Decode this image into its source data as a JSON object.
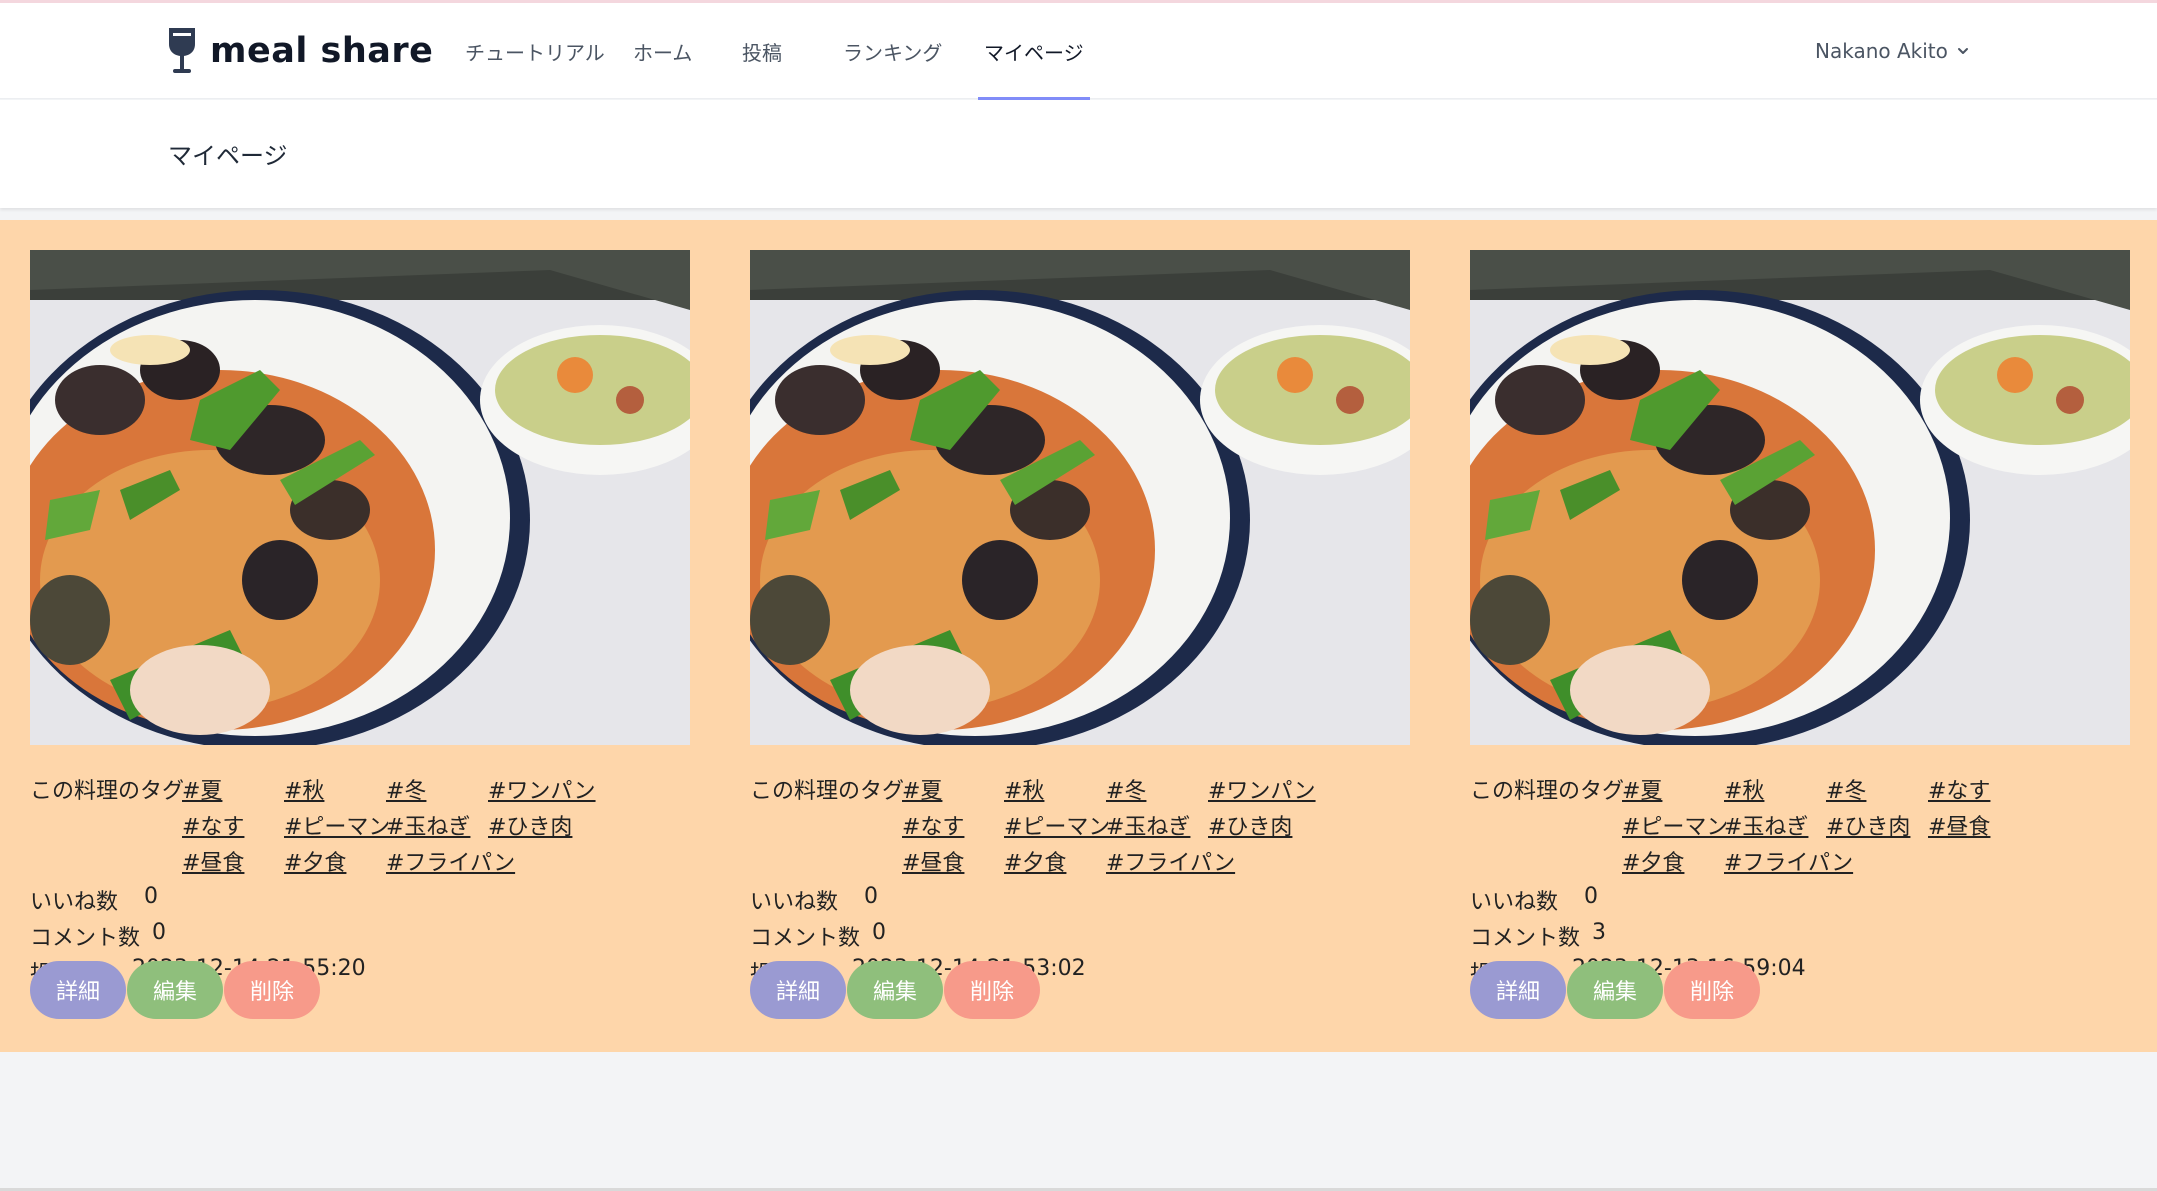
{
  "app": {
    "name": "meal share"
  },
  "nav": {
    "links": [
      {
        "label": "チュートリアル"
      },
      {
        "label": "ホーム"
      },
      {
        "label": "投稿"
      },
      {
        "label": "ランキング"
      },
      {
        "label": "マイページ",
        "active": true
      }
    ],
    "user": {
      "name": "Nakano Akito"
    }
  },
  "page": {
    "title": "マイページ"
  },
  "posts": [
    {
      "image": "photo-pasta-eggplant-pepper-with-soup",
      "tags_label": "この料理のタグ",
      "tags": [
        "#夏",
        "#秋",
        "#冬",
        "#ワンパン",
        "#なす",
        "#ピーマン",
        "#玉ねぎ",
        "#ひき肉",
        "#昼食",
        "#夕食",
        "#フライパン"
      ],
      "likes_label": "いいね数",
      "likes": "0",
      "comments_label": "コメント数",
      "comments": "0",
      "date_label": "投稿日",
      "date": "2023-12-14 21:55:20",
      "buttons": {
        "detail": "詳細",
        "edit": "編集",
        "delete": "削除"
      }
    },
    {
      "image": "photo-pasta-eggplant-pepper-with-soup",
      "tags_label": "この料理のタグ",
      "tags": [
        "#夏",
        "#秋",
        "#冬",
        "#ワンパン",
        "#なす",
        "#ピーマン",
        "#玉ねぎ",
        "#ひき肉",
        "#昼食",
        "#夕食",
        "#フライパン"
      ],
      "likes_label": "いいね数",
      "likes": "0",
      "comments_label": "コメント数",
      "comments": "0",
      "date_label": "投稿日",
      "date": "2023-12-14 21:53:02",
      "buttons": {
        "detail": "詳細",
        "edit": "編集",
        "delete": "削除"
      }
    },
    {
      "image": "photo-pasta-eggplant-pepper-with-soup",
      "tags_label": "この料理のタグ",
      "tags": [
        "#夏",
        "#秋",
        "#冬",
        "#なす",
        "#ピーマン",
        "#玉ねぎ",
        "#ひき肉",
        "#昼食",
        "#夕食",
        "#フライパン"
      ],
      "likes_label": "いいね数",
      "likes": "0",
      "comments_label": "コメント数",
      "comments": "3",
      "date_label": "投稿日",
      "date": "2023-12-13 16:59:04",
      "buttons": {
        "detail": "詳細",
        "edit": "編集",
        "delete": "削除"
      }
    }
  ],
  "colors": {
    "content_bg": "#fed6aa",
    "detail_button": "#9a9ad2",
    "edit_button": "#8fbf7c",
    "delete_button": "#f79a8a",
    "active_tab_indicator": "#818cf8"
  }
}
